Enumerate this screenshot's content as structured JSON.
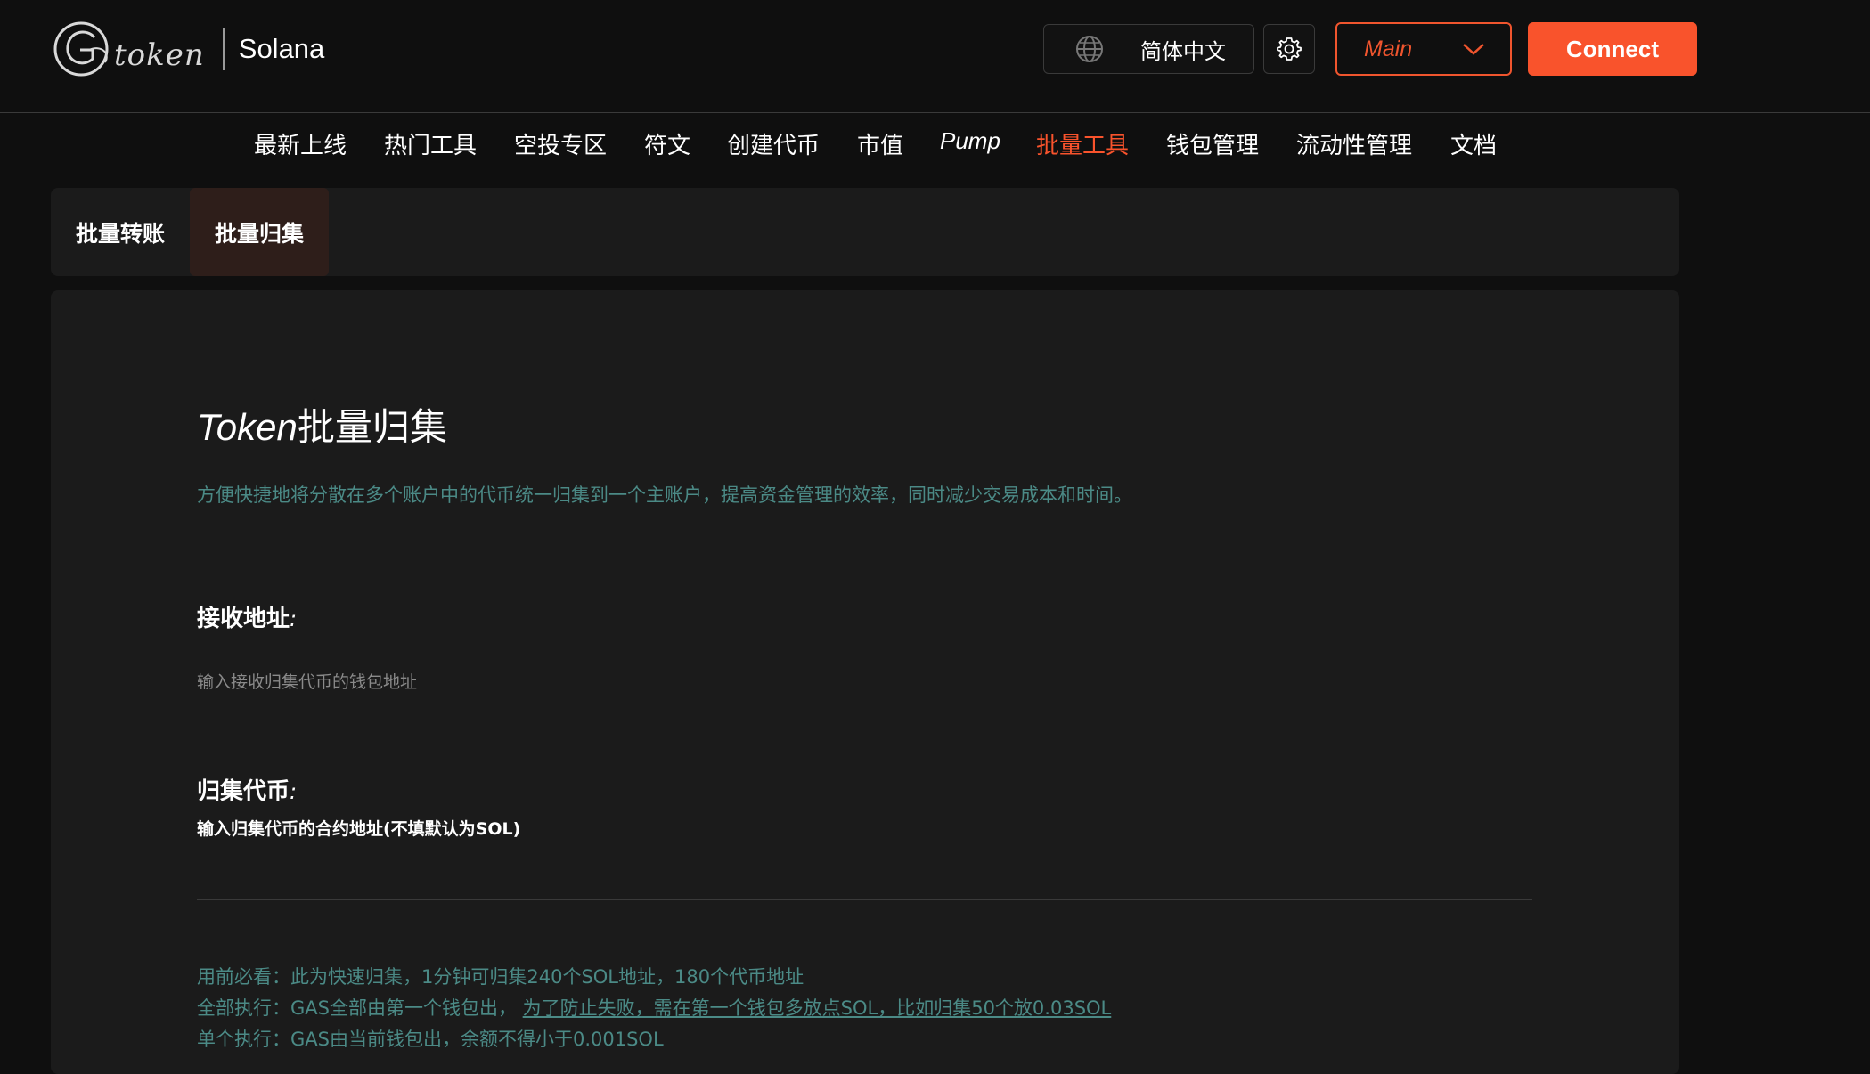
{
  "header": {
    "logo_word": "token",
    "chain_name": "Solana",
    "language": "简体中文",
    "network": "Main",
    "connect_label": "Connect"
  },
  "nav": {
    "items": [
      "最新上线",
      "热门工具",
      "空投专区",
      "符文",
      "创建代币",
      "市值",
      "Pump",
      "批量工具",
      "钱包管理",
      "流动性管理",
      "文档"
    ],
    "active": "批量工具"
  },
  "subtabs": {
    "items": [
      "批量转账",
      "批量归集"
    ],
    "active": "批量归集"
  },
  "panel": {
    "title_latin": "Token",
    "title_cn": "批量归集",
    "description": "方便快捷地将分散在多个账户中的代币统一归集到一个主账户，提高资金管理的效率，同时减少交易成本和时间。",
    "receive_label": "接收地址",
    "receive_placeholder": "输入接收归集代币的钱包地址",
    "token_label": "归集代币",
    "token_placeholder": "输入归集代币的合约地址(不填默认为SOL)",
    "colon": ":",
    "note_line1": "用前必看：此为快速归集，1分钟可归集240个SOL地址，180个代币地址",
    "note_line2_prefix": "全部执行：GAS全部由第一个钱包出， ",
    "note_line2_link": "为了防止失败，需在第一个钱包多放点SOL，比如归集50个放0.03SOL",
    "note_line3": "单个执行：GAS由当前钱包出，余额不得小于0.001SOL"
  },
  "colors": {
    "accent": "#f9532c",
    "teal_text": "#4b8a86",
    "background": "#0f0f0f",
    "panel": "#1b1b1b"
  },
  "icons": {
    "language": "globe-icon",
    "settings": "gear-icon",
    "network_dropdown": "chevron-down-icon"
  }
}
